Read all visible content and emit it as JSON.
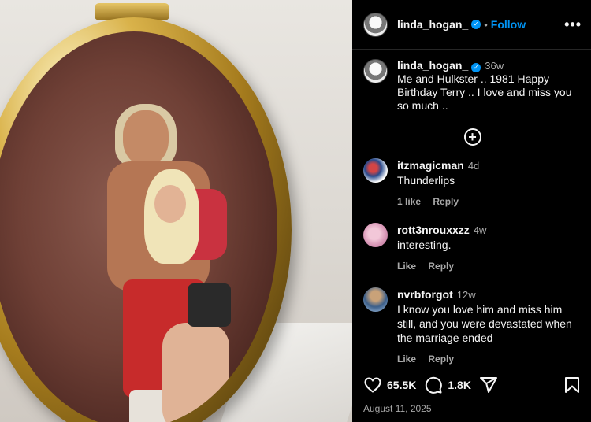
{
  "post": {
    "username": "linda_hogan_",
    "follow_label": "Follow",
    "dot": "•",
    "more_label": "•••"
  },
  "caption": {
    "username": "linda_hogan_",
    "age": "36w",
    "text": "Me and Hulkster .. 1981 Happy Birthday Terry .. I love and miss you so much .."
  },
  "load_more_label": "+",
  "comments": [
    {
      "username": "itzmagicman",
      "age": "4d",
      "text": "Thunderlips",
      "likes": "1 like",
      "reply": "Reply"
    },
    {
      "username": "rott3nrouxxzz",
      "age": "4w",
      "text": "interesting.",
      "likes": "Like",
      "reply": "Reply"
    },
    {
      "username": "nvrbforgot",
      "age": "12w",
      "text": "I know you love him and miss him still, and you were devastated when the marriage ended",
      "likes": "Like",
      "reply": "Reply"
    }
  ],
  "stats": {
    "likes": "65.5K",
    "comments": "1.8K"
  },
  "date": "August 11, 2025",
  "icons": {
    "like": "heart-icon",
    "comment": "comment-bubble-icon",
    "share": "send-plane-icon",
    "save": "bookmark-icon",
    "verified": "verified-badge-icon"
  },
  "colors": {
    "accent": "#0095f6",
    "muted": "#a8a8a8",
    "background": "#000000"
  }
}
